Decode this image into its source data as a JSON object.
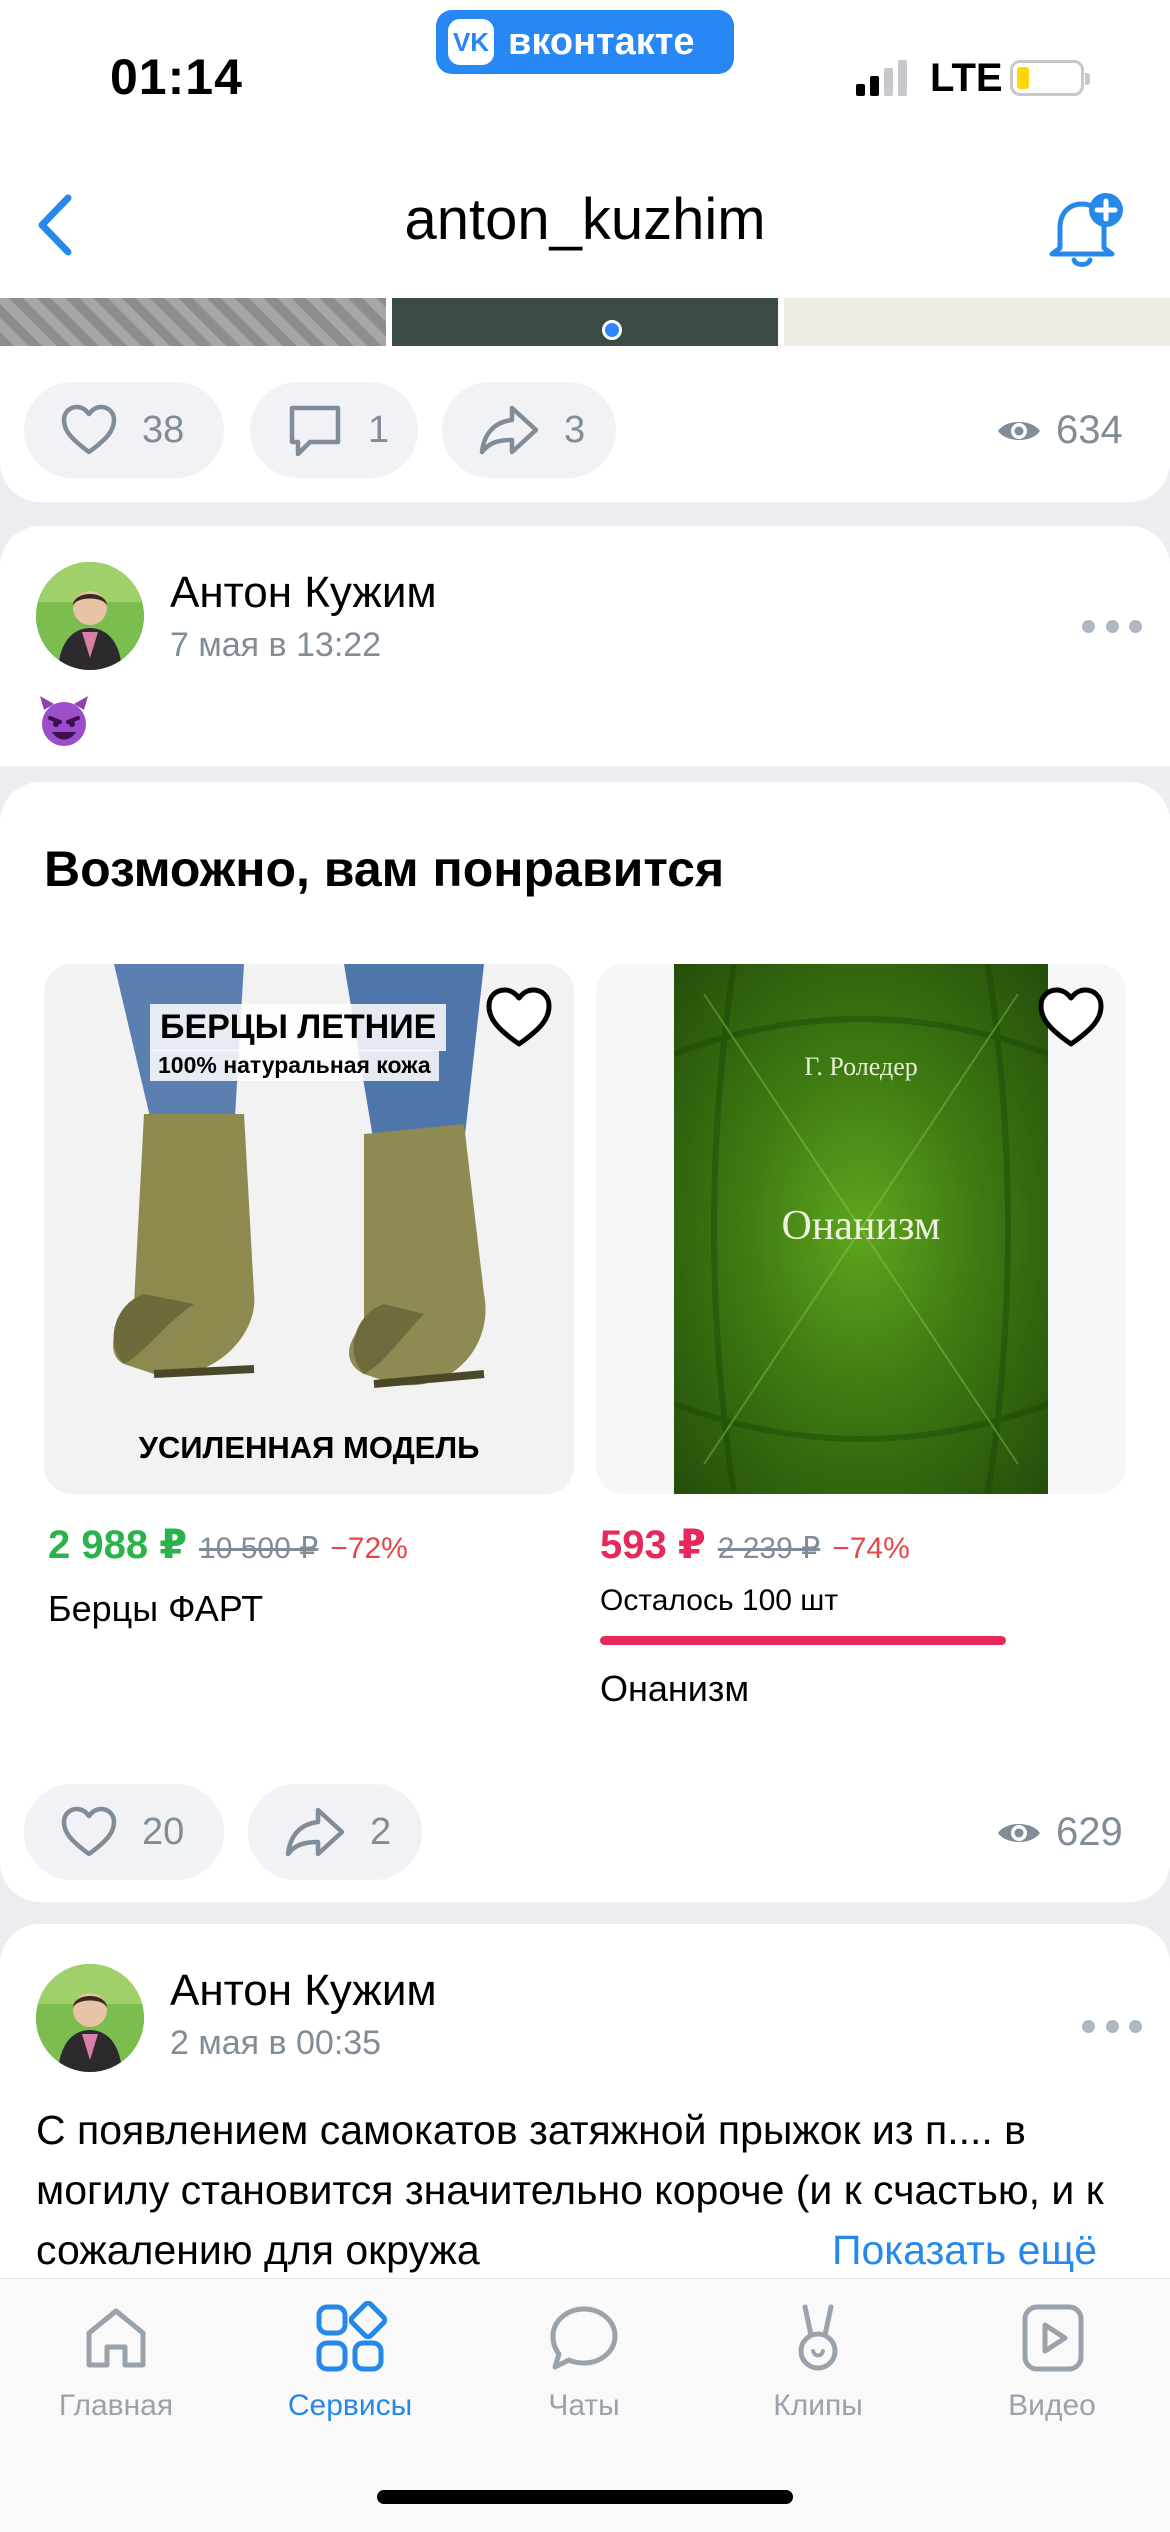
{
  "status_bar": {
    "time": "01:14",
    "app_badge": "вконтакте",
    "app_badge_logo": "VK",
    "network": "LTE"
  },
  "header": {
    "title": "anton_kuzhim"
  },
  "post1_footer": {
    "likes": "38",
    "comments": "1",
    "shares": "3",
    "views": "634"
  },
  "post2": {
    "author": "Антон Кужим",
    "date": "7 мая в 13:22",
    "content_emoji": "smiling-devil",
    "recommendations": {
      "title": "Возможно, вам понравится",
      "products": [
        {
          "name": "Берцы ФАРТ",
          "price": "2 988 ₽",
          "old_price": "10 500 ₽",
          "discount": "−72%",
          "image_caption_top": "БЕРЦЫ ЛЕТНИЕ",
          "image_caption_sub": "100% натуральная кожа",
          "image_caption_bottom": "УСИЛЕННАЯ МОДЕЛЬ"
        },
        {
          "name": "Онанизм",
          "price": "593 ₽",
          "old_price": "2 239 ₽",
          "discount": "−74%",
          "stock": "Осталось 100 шт",
          "stock_fraction": 0.6,
          "cover_author": "Г. Роледер",
          "cover_title": "Онанизм"
        }
      ]
    },
    "likes": "20",
    "shares": "2",
    "views": "629"
  },
  "post3": {
    "author": "Антон Кужим",
    "date": "2 мая в 00:35",
    "text": "С появлением самокатов затяжной прыжок из п.... в могилу становится значительно короче (и к счастью, и к сожалению для окружа",
    "show_more": "Показать ещё"
  },
  "tabbar": {
    "items": [
      {
        "label": "Главная",
        "icon": "home-icon"
      },
      {
        "label": "Сервисы",
        "icon": "services-icon"
      },
      {
        "label": "Чаты",
        "icon": "chat-icon"
      },
      {
        "label": "Клипы",
        "icon": "clips-icon"
      },
      {
        "label": "Видео",
        "icon": "video-icon"
      }
    ],
    "active": "Сервисы"
  },
  "colors": {
    "accent": "#2688eb",
    "sale_green": "#2bb34b",
    "sale_red": "#e6285a",
    "muted": "#818c99"
  }
}
